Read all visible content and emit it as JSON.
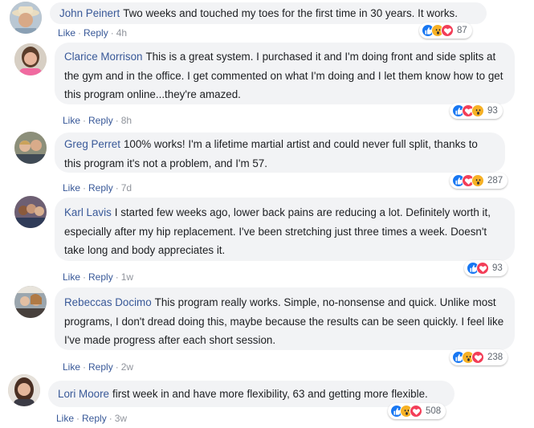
{
  "comments": [
    {
      "author": "John Peinert",
      "text": "Two weeks and touched my toes for the first time in 30 years. It works.",
      "like_label": "Like",
      "reply_label": "Reply",
      "time": "4h",
      "reactions": [
        "like",
        "wow",
        "love"
      ],
      "reaction_count": "87"
    },
    {
      "author": "Clarice Morrison",
      "text": "This is a great system. I purchased it and I'm doing front and side splits at the gym and in the office. I get commented on what I'm doing and I let them know how to get this program online...they're amazed.",
      "like_label": "Like",
      "reply_label": "Reply",
      "time": "8h",
      "reactions": [
        "like",
        "love",
        "wow"
      ],
      "reaction_count": "93"
    },
    {
      "author": "Greg Perret",
      "text": "100% works! I'm a lifetime martial artist and could never full split, thanks to this program it's not a problem, and I'm 57.",
      "like_label": "Like",
      "reply_label": "Reply",
      "time": "7d",
      "reactions": [
        "like",
        "love",
        "wow"
      ],
      "reaction_count": "287"
    },
    {
      "author": "Karl Lavis",
      "text": "I started few weeks ago, lower back pains are reducing a lot. Definitely worth it, especially after my hip replacement. I've been stretching just three times a week. Doesn't take long and body appreciates it.",
      "like_label": "Like",
      "reply_label": "Reply",
      "time": "1w",
      "reactions": [
        "like",
        "love"
      ],
      "reaction_count": "93"
    },
    {
      "author": "Rebeccas Docimo",
      "text": "This program really works. Simple, no-nonsense and quick. Unlike most programs, I don't dread doing this, maybe because the results can be seen quickly. I feel like I've made progress after each short session.",
      "like_label": "Like",
      "reply_label": "Reply",
      "time": "2w",
      "reactions": [
        "like",
        "wow",
        "love"
      ],
      "reaction_count": "238"
    },
    {
      "author": "Lori Moore",
      "text": "first week in and have more flexibility, 63 and getting more flexible.",
      "like_label": "Like",
      "reply_label": "Reply",
      "time": "3w",
      "reactions": [
        "like",
        "wow",
        "love"
      ],
      "reaction_count": "508"
    }
  ],
  "colors": {
    "name_link": "#385898",
    "bubble_bg": "#f2f3f5",
    "like": "#1877f2",
    "love": "#f33e58",
    "wow": "#f7b125"
  }
}
